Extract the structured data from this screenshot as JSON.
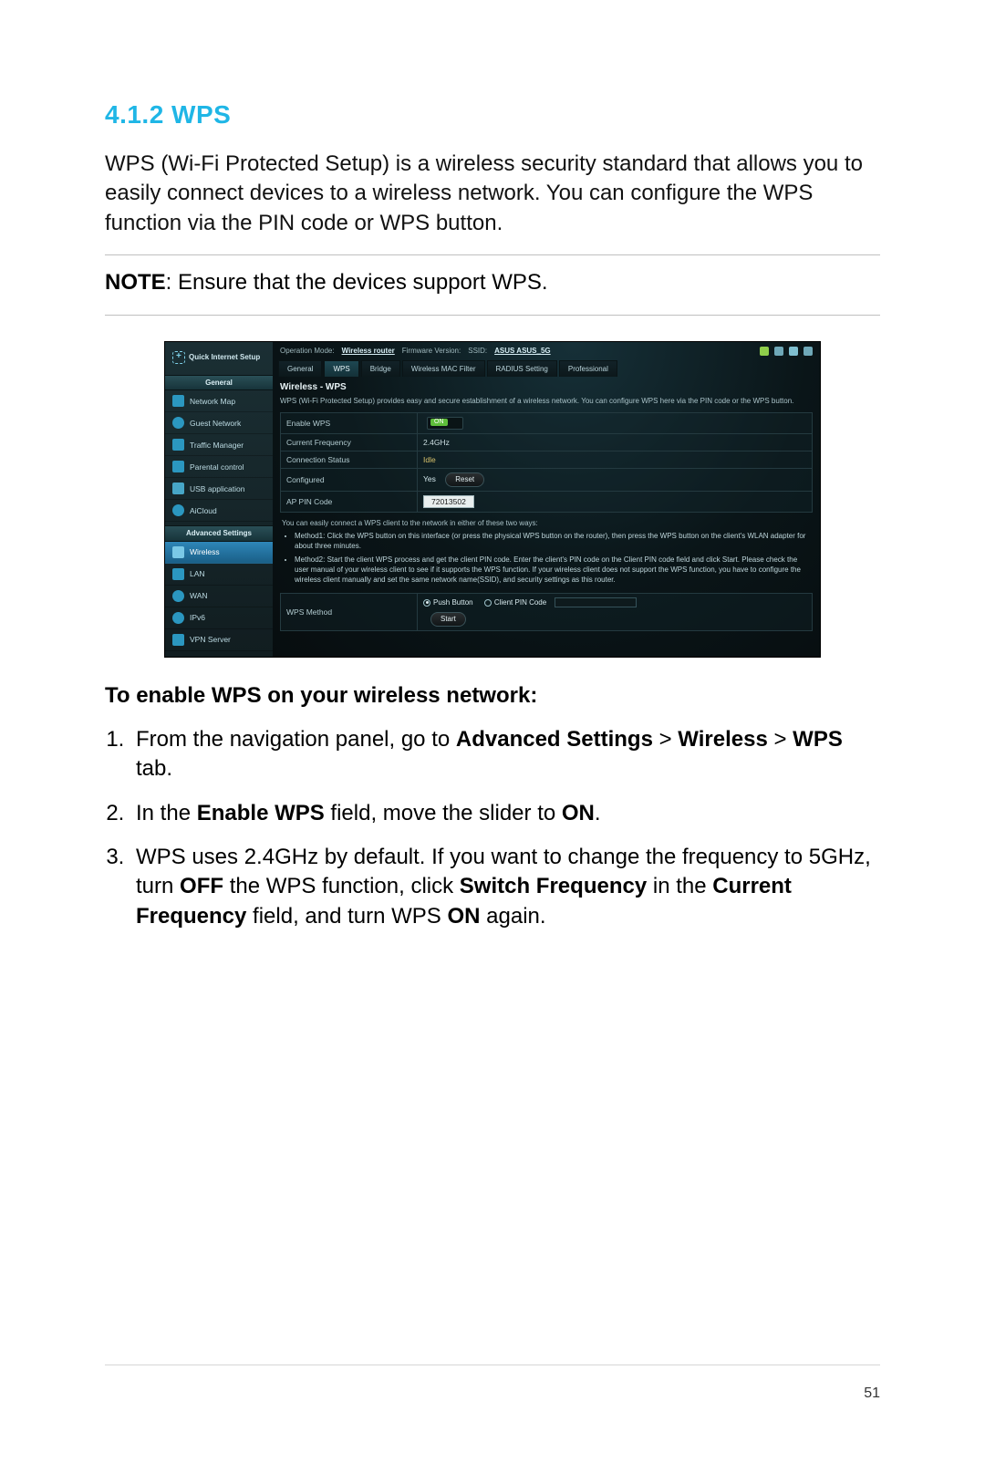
{
  "heading": "4.1.2 WPS",
  "intro": "WPS (Wi-Fi Protected Setup) is a wireless security standard that allows you to easily connect devices to a wireless network. You can configure the WPS function via the PIN code or WPS button.",
  "note_label": "NOTE",
  "note_text": ":  Ensure that the devices support WPS.",
  "subhead": "To enable WPS on your wireless network:",
  "steps": {
    "s1_a": "From the navigation panel, go to ",
    "s1_b": "Advanced Settings",
    "s1_c": " > ",
    "s1_d": "Wireless",
    "s1_e": " > ",
    "s1_f": "WPS",
    "s1_g": " tab.",
    "s2_a": "In the ",
    "s2_b": "Enable WPS",
    "s2_c": " field, move the slider to ",
    "s2_d": "ON",
    "s2_e": ".",
    "s3_a": "WPS uses 2.4GHz by default. If you want to change the frequency to 5GHz, turn ",
    "s3_b": "OFF",
    "s3_c": " the WPS function, click ",
    "s3_d": "Switch Frequency",
    "s3_e": " in the ",
    "s3_f": "Current Frequency",
    "s3_g": " field, and turn WPS ",
    "s3_h": "ON",
    "s3_i": " again."
  },
  "page_number": "51",
  "router": {
    "qis": "Quick Internet Setup",
    "sidebar_general_header": "General",
    "sidebar_general": [
      "Network Map",
      "Guest Network",
      "Traffic Manager",
      "Parental control",
      "USB application",
      "AiCloud"
    ],
    "sidebar_adv_header": "Advanced Settings",
    "sidebar_adv": [
      "Wireless",
      "LAN",
      "WAN",
      "IPv6",
      "VPN Server"
    ],
    "topbar": {
      "op_label": "Operation Mode:",
      "op_value": "Wireless router",
      "fw_label": "Firmware Version:",
      "ssid_label": "SSID:",
      "ssid_value": "ASUS  ASUS_5G"
    },
    "tabs": [
      "General",
      "WPS",
      "Bridge",
      "Wireless MAC Filter",
      "RADIUS Setting",
      "Professional"
    ],
    "panel_title": "Wireless - WPS",
    "panel_desc": "WPS (Wi-Fi Protected Setup) provides easy and secure establishment of a wireless network. You can configure WPS here via the PIN code or the WPS button.",
    "rows": {
      "enable": "Enable WPS",
      "freq": "Current Frequency",
      "freq_v": "2.4GHz",
      "conn": "Connection Status",
      "conn_v": "Idle",
      "conf": "Configured",
      "conf_v": "Yes",
      "reset": "Reset",
      "pin": "AP PIN Code",
      "pin_v": "72013502",
      "method": "WPS Method",
      "start": "Start"
    },
    "methods_intro": "You can easily connect a WPS client to the network in either of these two ways:",
    "method1": "Method1: Click the WPS button on this interface (or press the physical WPS button on the router), then press the WPS button on the client's WLAN adapter for about three minutes.",
    "method2": "Method2: Start the client WPS process and get the client PIN code. Enter the client's PIN code on the Client PIN code field and click Start. Please check the user manual of your wireless client to see if it supports the WPS function. If your wireless client does not support the WPS function, you have to configure the wireless client manually and set the same network name(SSID), and security settings as this router.",
    "radio": {
      "push": "Push Button",
      "clientpin": "Client PIN Code"
    }
  }
}
